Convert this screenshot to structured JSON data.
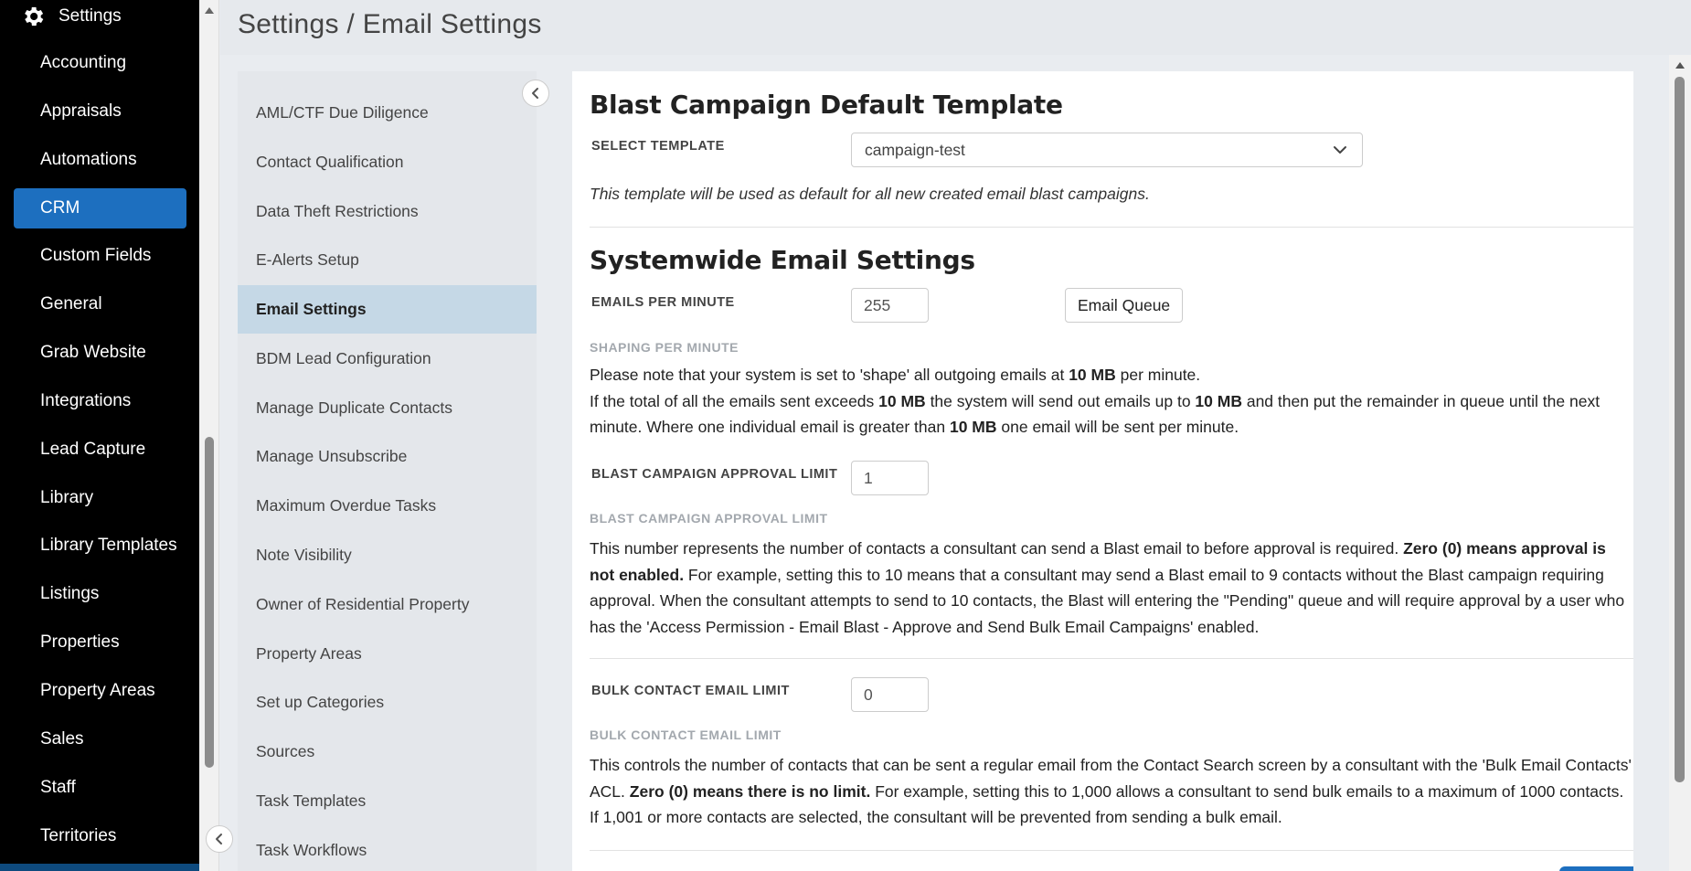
{
  "header": {
    "title": "Settings / Email Settings"
  },
  "sidebar": {
    "title": "Settings",
    "title_icon": "gear-icon",
    "items": [
      {
        "label": "Accounting"
      },
      {
        "label": "Appraisals"
      },
      {
        "label": "Automations"
      },
      {
        "label": "CRM",
        "active": true
      },
      {
        "label": "Custom Fields"
      },
      {
        "label": "General"
      },
      {
        "label": "Grab Website"
      },
      {
        "label": "Integrations"
      },
      {
        "label": "Lead Capture"
      },
      {
        "label": "Library"
      },
      {
        "label": "Library Templates"
      },
      {
        "label": "Listings"
      },
      {
        "label": "Properties"
      },
      {
        "label": "Property Areas"
      },
      {
        "label": "Sales"
      },
      {
        "label": "Staff"
      },
      {
        "label": "Territories"
      }
    ]
  },
  "submenu": {
    "items": [
      {
        "label": "AML/CTF Due Diligence"
      },
      {
        "label": "Contact Qualification"
      },
      {
        "label": "Data Theft Restrictions"
      },
      {
        "label": "E-Alerts Setup"
      },
      {
        "label": "Email Settings",
        "active": true
      },
      {
        "label": "BDM Lead Configuration"
      },
      {
        "label": "Manage Duplicate Contacts"
      },
      {
        "label": "Manage Unsubscribe"
      },
      {
        "label": "Maximum Overdue Tasks"
      },
      {
        "label": "Note Visibility"
      },
      {
        "label": "Owner of Residential Property"
      },
      {
        "label": "Property Areas"
      },
      {
        "label": "Set up Categories"
      },
      {
        "label": "Sources"
      },
      {
        "label": "Task Templates"
      },
      {
        "label": "Task Workflows"
      }
    ]
  },
  "blast_template": {
    "heading": "Blast Campaign Default Template",
    "select_label": "SELECT TEMPLATE",
    "select_value": "campaign-test",
    "note": "This template will be used as default for all new created email blast campaigns."
  },
  "systemwide": {
    "heading": "Systemwide Email Settings",
    "emails_per_minute_label": "EMAILS PER MINUTE",
    "emails_per_minute_value": "255",
    "email_queue_button": "Email Queue",
    "shaping_label": "SHAPING PER MINUTE",
    "shaping_p1_a": "Please note that your system is set to 'shape' all outgoing emails at ",
    "shaping_p1_b": "10 MB",
    "shaping_p1_c": " per minute.",
    "shaping_p2_a": "If the total of all the emails sent exceeds ",
    "shaping_p2_b": "10 MB",
    "shaping_p2_c": " the system will send out emails up to ",
    "shaping_p2_d": "10 MB",
    "shaping_p2_e": " and then put the remainder in queue until the next minute. Where one individual email is greater than ",
    "shaping_p2_f": "10 MB",
    "shaping_p2_g": " one email will be sent per minute.",
    "approval_label": "BLAST CAMPAIGN APPROVAL LIMIT",
    "approval_value": "1",
    "approval_sublabel": "BLAST CAMPAIGN APPROVAL LIMIT",
    "approval_p_a": "This number represents the number of contacts a consultant can send a Blast email to before approval is required. ",
    "approval_p_b": "Zero (0) means approval is not enabled.",
    "approval_p_c": " For example, setting this to 10 means that a consultant may send a Blast email to 9 contacts without the Blast campaign requiring approval. When the consultant attempts to send to 10 contacts, the Blast will entering the \"Pending\" queue and will require approval by a user who has the 'Access Permission - Email Blast - Approve and Send Bulk Email Campaigns' enabled.",
    "bulk_label": "BULK CONTACT EMAIL LIMIT",
    "bulk_value": "0",
    "bulk_sublabel": "BULK CONTACT EMAIL LIMIT",
    "bulk_p_a": "This controls the number of contacts that can be sent a regular email from the Contact Search screen by a consultant with the 'Bulk Email Contacts' ACL. ",
    "bulk_p_b": "Zero (0) means there is no limit.",
    "bulk_p_c": " For example, setting this to 1,000 allows a consultant to send bulk emails to a maximum of 1000 contacts. If 1,001 or more contacts are selected, the consultant will be prevented from sending a bulk email."
  },
  "colors": {
    "accent": "#1d6fbf",
    "active_submenu": "#c5d8e6",
    "sidebar_bg": "#000000"
  }
}
